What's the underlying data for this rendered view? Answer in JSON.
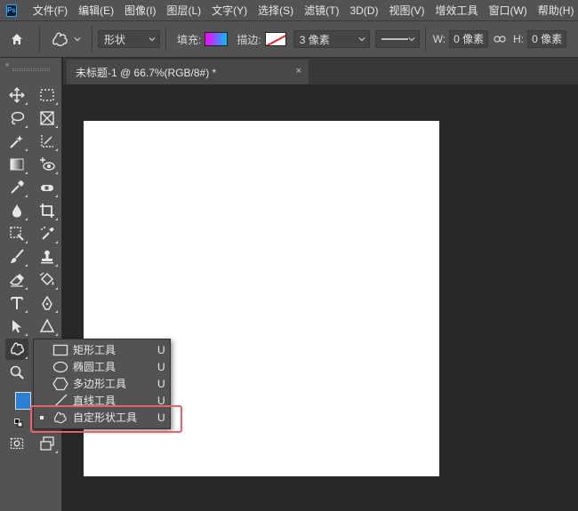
{
  "app": {
    "logo": "Ps"
  },
  "menu": [
    "文件(F)",
    "编辑(E)",
    "图像(I)",
    "图层(L)",
    "文字(Y)",
    "选择(S)",
    "滤镜(T)",
    "3D(D)",
    "视图(V)",
    "增效工具",
    "窗口(W)",
    "帮助(H)"
  ],
  "options": {
    "mode": "形状",
    "fill_label": "填充:",
    "stroke_label": "描边:",
    "stroke_width": "3 像素",
    "w_label": "W:",
    "w_value": "0 像素",
    "h_label": "H:",
    "h_value": "0 像素"
  },
  "document": {
    "tab_title": "未标题-1 @ 66.7%(RGB/8#) *",
    "close": "×"
  },
  "toolbar": {
    "collapse": "«"
  },
  "flyout": [
    {
      "label": "矩形工具",
      "key": "U",
      "icon": "rectangle-icon",
      "selected": false
    },
    {
      "label": "椭圆工具",
      "key": "U",
      "icon": "ellipse-icon",
      "selected": false
    },
    {
      "label": "多边形工具",
      "key": "U",
      "icon": "polygon-icon",
      "selected": false
    },
    {
      "label": "直线工具",
      "key": "U",
      "icon": "line-icon",
      "selected": false
    },
    {
      "label": "自定形状工具",
      "key": "U",
      "icon": "custom-shape-icon",
      "selected": true
    }
  ],
  "colors": {
    "foreground": "#2b7fd4",
    "background": "#ffffff",
    "highlight": "#e8626b",
    "accent": "#31a8ff"
  }
}
